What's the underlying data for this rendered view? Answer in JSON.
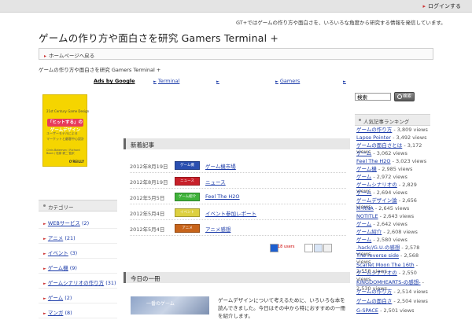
{
  "topbar": {
    "login": "ログインする"
  },
  "site": {
    "title": "ゲームの作り方や面白さを研究 Gamers Terminal +",
    "description": "GT+ではゲームの作り方や面白さを、いろいろな角度から研究する情報を発信しています。"
  },
  "nav": {
    "home": "ホームページへ戻る"
  },
  "breadcrumb": "ゲームの作り方や面白さを研究 Gamers Terminal +",
  "adrow": {
    "ads": "Ads by Google",
    "links": [
      "Terminal",
      "",
      "Gamers",
      ""
    ]
  },
  "book": {
    "subtitle": "21st Century Game Design",
    "title": "「ヒットする」のゲームデザイン",
    "line1": "ユーザーモデルによる",
    "line2": "マーケットと顧客中心設計",
    "authors": "Chris Bateman / Richard Boon / 松原 健二 監訳",
    "publisher": "O'REILLY"
  },
  "sidebar": {
    "heading": "カテゴリー",
    "categories": [
      {
        "label": "WEBサービス",
        "count": "(2)"
      },
      {
        "label": "アニメ",
        "count": "(21)"
      },
      {
        "label": "イベント",
        "count": "(3)"
      },
      {
        "label": "ゲーム機",
        "count": "(9)"
      },
      {
        "label": "ゲームシナリオの作り方",
        "count": "(31)"
      },
      {
        "label": "ゲーム",
        "count": "(2)"
      },
      {
        "label": "マンガ",
        "count": "(8)"
      }
    ]
  },
  "main": {
    "new_heading": "新着記事",
    "posts": [
      {
        "date": "2012年8月19日",
        "badge": "ゲーム機",
        "badge_color": "#2a4fb0",
        "title": "ゲーム機市場"
      },
      {
        "date": "2012年8月19日",
        "badge": "ニュース",
        "badge_color": "#c8202a",
        "title": "ニュース"
      },
      {
        "date": "2012年5月5日",
        "badge": "ゲーム紹介",
        "badge_color": "#3fb23a",
        "title": "Feel The H2O"
      },
      {
        "date": "2012年5月4日",
        "badge": "イベント",
        "badge_color": "#ddd040",
        "title": "イベント参加レポート"
      },
      {
        "date": "2012年5月4日",
        "badge": "アニメ",
        "badge_color": "#c8641a",
        "title": "アニメ感想"
      }
    ],
    "share_count": "18 users",
    "section2_heading": "今日の一冊",
    "section2_image_caption": "一番のゲーム",
    "section2_text": "ゲームデザインについて考えるために、いろいろな本を読んできました。今日はその中から特におすすめの一冊を紹介します。"
  },
  "search": {
    "value": "検索",
    "button": "検索"
  },
  "ranking": {
    "heading": "人気記事ランキング",
    "items": [
      {
        "title": "ゲームの作り方",
        "views": "3,809 views"
      },
      {
        "title": "Lapse Pointer",
        "views": "3,492 views"
      },
      {
        "title": "ゲームの面白さとは",
        "views": "3,172 views"
      },
      {
        "title": "ゲーム",
        "views": "3,062 views"
      },
      {
        "title": "Feel The H2O",
        "views": "3,023 views"
      },
      {
        "title": "ゲーム機",
        "views": "2,985 views"
      },
      {
        "title": "ゲーム",
        "views": "2,972 views"
      },
      {
        "title": "ゲームシナリオの",
        "views": "2,829 views"
      },
      {
        "title": "ゲーム",
        "views": "2,694 views"
      },
      {
        "title": "ゲームデザイン論",
        "views": "2,656 views"
      },
      {
        "title": "M-RNA",
        "views": "2,645 views"
      },
      {
        "title": "NOTITLE",
        "views": "2,643 views"
      },
      {
        "title": "ゲーム",
        "views": "2,642 views"
      },
      {
        "title": "ゲーム紹介",
        "views": "2,608 views"
      },
      {
        "title": "ゲーム",
        "views": "2,580 views"
      },
      {
        "title": ".hack//G.U.の感想",
        "views": "2,578 views"
      },
      {
        "title": "The reverse side",
        "views": "2,568 views"
      },
      {
        "title": "Scarlet Moon The 16th",
        "views": "2,558 views"
      },
      {
        "title": "ゲームシナリオの",
        "views": "2,550 views"
      },
      {
        "title": "KINGDOMHEARTS-の感想-",
        "views": "2,530 views"
      },
      {
        "title": "ゲームの作り方",
        "views": "2,514 views"
      },
      {
        "title": "ゲームの面白さ",
        "views": "2,504 views"
      },
      {
        "title": "G-SPACE",
        "views": "2,501 views"
      }
    ]
  }
}
